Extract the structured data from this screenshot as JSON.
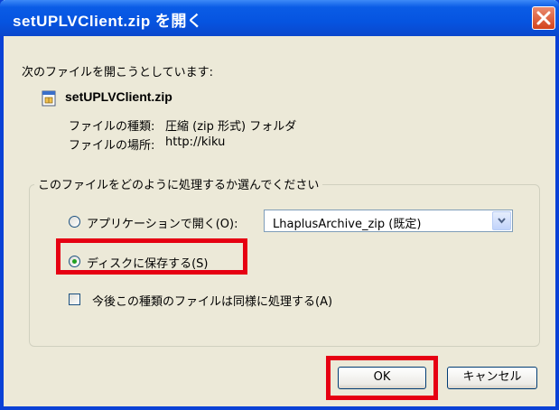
{
  "window": {
    "title": "setUPLVClient.zip を開く"
  },
  "dialog": {
    "intro": "次のファイルを開こうとしています:",
    "file_name": "setUPLVClient.zip",
    "file_type_label": "ファイルの種類:",
    "file_type_value": "圧縮 (zip 形式) フォルダ",
    "file_location_label": "ファイルの場所:",
    "file_location_value": "http://kiku"
  },
  "action_group": {
    "legend": "このファイルをどのように処理するか選んでください",
    "open_with_label": "アプリケーションで開く(O):",
    "open_with_selected": false,
    "app_select_value": "LhaplusArchive_zip (既定)",
    "save_to_disk_label": "ディスクに保存する(S)",
    "save_to_disk_selected": true,
    "remember_label": "今後この種類のファイルは同様に処理する(A)",
    "remember_checked": false
  },
  "buttons": {
    "ok": "OK",
    "cancel": "キャンセル"
  },
  "colors": {
    "highlight": "#e60012",
    "titlebar": "#0a5ce6",
    "dialog_bg": "#ece9d8",
    "radio_dot": "#21a121"
  },
  "icons": {
    "file": "zip-file-icon",
    "close": "close-icon",
    "dropdown": "chevron-down-icon"
  }
}
